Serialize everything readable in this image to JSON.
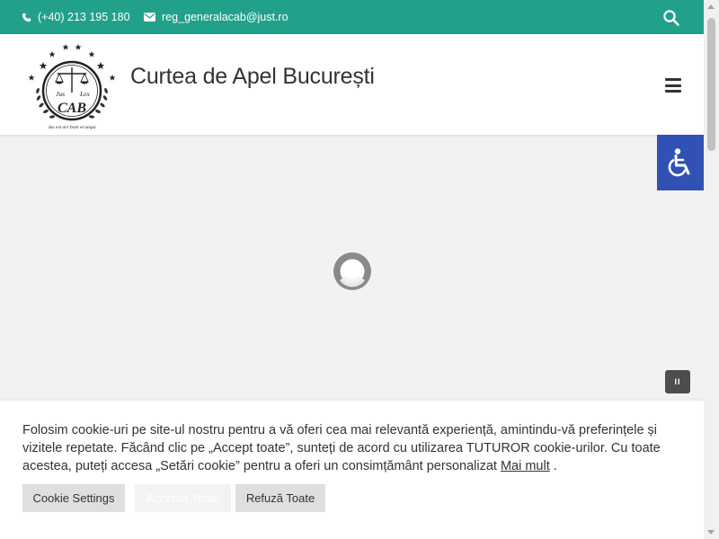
{
  "topbar": {
    "phone": "(+40) 213 195 180",
    "email": "reg_generalacab@just.ro",
    "background": "#21a18a"
  },
  "header": {
    "site_title": "Curtea de Apel București",
    "logo": {
      "words": [
        "Jus",
        "Lex",
        "CAB"
      ],
      "motto": "Jus est ars boni et aequi"
    }
  },
  "icons": {
    "phone": "phone-icon",
    "email": "envelope-icon",
    "search": "search-icon",
    "menu": "hamburger-menu-icon",
    "accessibility": "wheelchair-icon",
    "loader": "loading-spinner-icon",
    "pause": "pause-icon"
  },
  "accessibility_color": "#3152b4",
  "cookie": {
    "text_main": "Folosim cookie-uri pe site-ul nostru pentru a vă oferi cea mai relevantă experiență, amintindu-vă preferințele și vizitele repetate. Făcând clic pe „Accept toate”, sunteți de acord cu utilizarea TUTUROR cookie-urilor. Cu toate acestea, puteți accesa „Setări cookie” pentru a oferi un consimțământ personalizat",
    "more_link": "Mai mult",
    "text_end": " .",
    "buttons": {
      "settings": "Cookie Settings",
      "accept": "Accepta Toate",
      "reject": "Refuză Toate"
    }
  },
  "pause_label": "II"
}
